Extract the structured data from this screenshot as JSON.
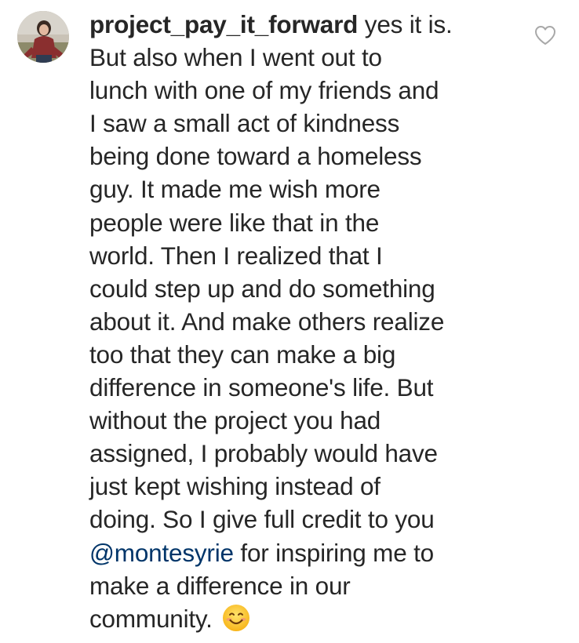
{
  "comment": {
    "username": "project_pay_it_forward",
    "lines": [
      " yes it is.",
      "But also when I went out to",
      "lunch with one of my friends and",
      "I saw a small act of kindness",
      "being done toward a homeless",
      "guy. It made me wish more",
      "people were like that in the",
      "world. Then I realized that I",
      "could step up and do something",
      "about it. And make others realize",
      "too that they can make a big",
      "difference in someone's life. But",
      "without the project you had",
      "assigned, I probably would have",
      "just kept wishing instead of",
      "doing. So I give full credit to you"
    ],
    "mention": "@montesyrie",
    "mention_tail": " for inspiring me to",
    "line_after_mention": "make a difference in our",
    "last_line": "community. ",
    "emoji": "smiling-face-emoji"
  },
  "icons": {
    "like": "heart-outline-icon",
    "avatar": "profile-photo"
  },
  "colors": {
    "text": "#262626",
    "mention": "#003569",
    "heart_stroke": "#a8a8a8",
    "background": "#ffffff"
  }
}
